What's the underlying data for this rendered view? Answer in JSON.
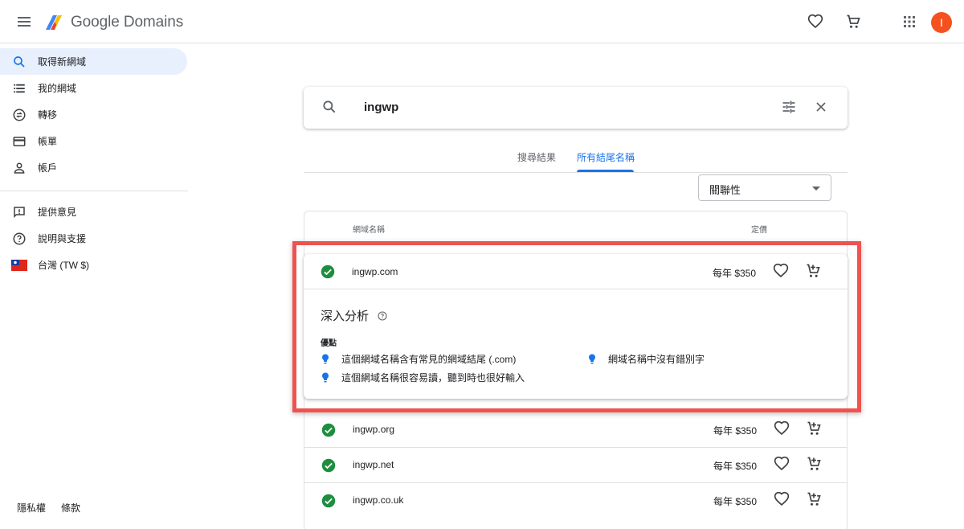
{
  "header": {
    "brand": "Google Domains",
    "avatar_initial": "I",
    "brand_color": "#5f6368",
    "avatar_color": "#f4511e"
  },
  "sidebar": {
    "items": [
      {
        "label": "取得新網域",
        "icon": "search-icon",
        "active": true
      },
      {
        "label": "我的網域",
        "icon": "list-icon"
      },
      {
        "label": "轉移",
        "icon": "transfer-icon"
      },
      {
        "label": "帳單",
        "icon": "credit-card-icon"
      },
      {
        "label": "帳戶",
        "icon": "person-icon"
      }
    ],
    "secondary": [
      {
        "label": "提供意見",
        "icon": "feedback-icon"
      },
      {
        "label": "說明與支援",
        "icon": "help-icon"
      },
      {
        "label": "台灣 (TW $)",
        "icon": "taiwan-flag-icon"
      }
    ],
    "footer": {
      "privacy": "隱私權",
      "terms": "條款"
    }
  },
  "search": {
    "query": "ingwp"
  },
  "tabs": [
    {
      "label": "搜尋結果",
      "active": false
    },
    {
      "label": "所有結尾名稱",
      "active": true
    }
  ],
  "sort": {
    "selected": "關聯性"
  },
  "table": {
    "col_domain": "網域名稱",
    "col_price": "定價"
  },
  "expanded": {
    "domain": "ingwp.com",
    "price": "每年 $350",
    "insight_title": "深入分析",
    "pros_label": "優點",
    "pros": [
      "這個網域名稱含有常見的網域結尾 (.com)",
      "網域名稱中沒有錯別字",
      "這個網域名稱很容易讀，聽到時也很好輸入"
    ]
  },
  "rows": [
    {
      "domain": "ingwp.org",
      "price": "每年 $350"
    },
    {
      "domain": "ingwp.net",
      "price": "每年 $350"
    },
    {
      "domain": "ingwp.co.uk",
      "price": "每年 $350"
    }
  ],
  "colors": {
    "accent": "#1a73e8",
    "available": "#1e8e3e",
    "highlight_border": "#ef5350",
    "active_nav_bg": "#e8f0fe"
  }
}
